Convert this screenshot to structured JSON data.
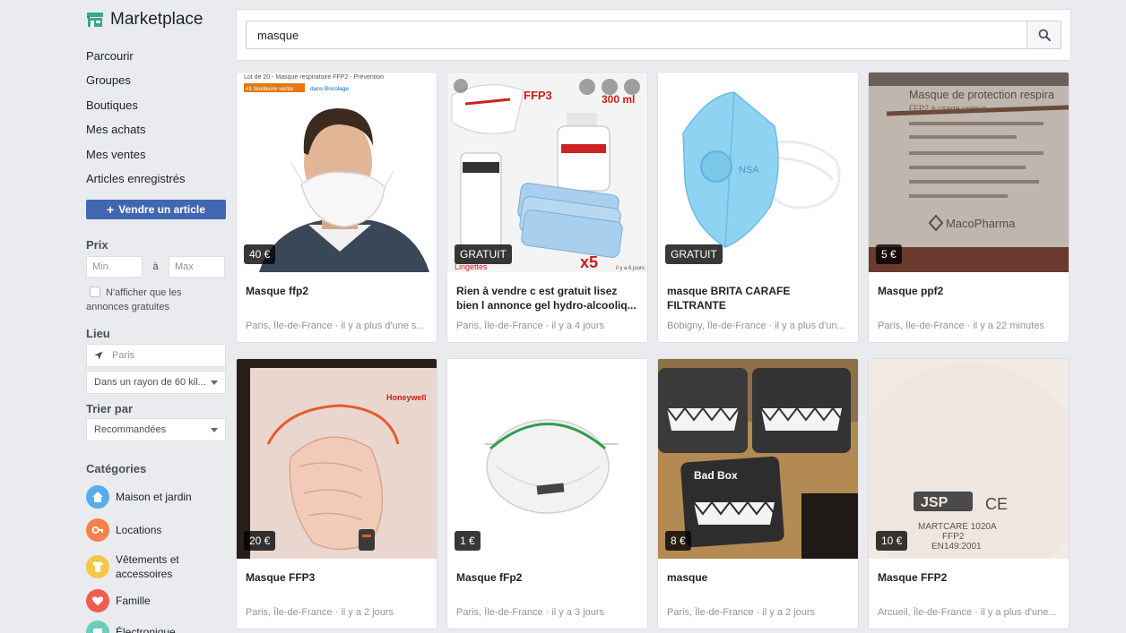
{
  "app": {
    "title": "Marketplace",
    "icon": "shop-icon"
  },
  "nav": [
    {
      "label": "Parcourir"
    },
    {
      "label": "Groupes"
    },
    {
      "label": "Boutiques"
    },
    {
      "label": "Mes achats"
    },
    {
      "label": "Mes ventes"
    },
    {
      "label": "Articles enregistrés"
    }
  ],
  "sell_button": {
    "label": "Vendre un article",
    "icon": "plus-icon"
  },
  "filters": {
    "price": {
      "title": "Prix",
      "min_placeholder": "Min.",
      "separator": "à",
      "max_placeholder": "Max",
      "free_only_label": "N'afficher que les annonces gratuites"
    },
    "location": {
      "title": "Lieu",
      "city": "Paris",
      "radius": "Dans un rayon de 60 kil..."
    },
    "sort": {
      "title": "Trier par",
      "value": "Recommandées"
    }
  },
  "categories": {
    "title": "Catégories",
    "items": [
      {
        "label": "Maison et jardin",
        "icon": "house-icon",
        "color": "#55acee"
      },
      {
        "label": "Locations",
        "icon": "key-icon",
        "color": "#f7814a"
      },
      {
        "label": "Vêtements et accessoires",
        "icon": "clothing-icon",
        "color": "#f7c644"
      },
      {
        "label": "Famille",
        "icon": "heart-icon",
        "color": "#f25b4d"
      },
      {
        "label": "Électronique",
        "icon": "electronics-icon",
        "color": "#6bcebb"
      }
    ]
  },
  "search": {
    "value": "masque",
    "icon": "search-icon"
  },
  "listings": [
    {
      "price": "40 €",
      "title": "Masque ffp2",
      "meta": "Paris, Île-de-France · il y a plus d'une s...",
      "img_banner": "Lot de 20 - Masque respiratoire FFP2 - Prévention",
      "img_tag": "#1 Meilleure vente",
      "img_tag2": "dans Bricolage"
    },
    {
      "price": "GRATUIT",
      "title": "Rien à vendre c est gratuit lisez bien l annonce gel hydro-alcooliq...",
      "meta": "Paris, Île-de-France · il y a 4 jours",
      "img_ffp3": "FFP3",
      "img_ml": "300 ml",
      "img_x5": "x5",
      "img_small": "Lingettes",
      "img_time": "il y a 6 jours"
    },
    {
      "price": "GRATUIT",
      "title": "masque BRITA CARAFE FILTRANTE",
      "meta": "Bobigny, Île-de-France · il y a plus d'un...",
      "img_text": "NSA"
    },
    {
      "price": "5 €",
      "title": "Masque ppf2",
      "meta": "Paris, Île-de-France · il y a 22 minutes",
      "img_heading": "Masque de protection respira",
      "img_sub": "FFP2 à usage unique",
      "img_brand": "MacoPharma"
    },
    {
      "price": "20 €",
      "title": "Masque FFP3",
      "meta": "Paris, Île-de-France · il y a 2 jours",
      "img_brand": "Honeywell"
    },
    {
      "price": "1 €",
      "title": "Masque fFp2",
      "meta": "Paris, Île-de-France · il y a 3 jours"
    },
    {
      "price": "8 €",
      "title": "masque",
      "meta": "Paris, Île-de-France · il y a 2 jours",
      "img_text": "Bad Box"
    },
    {
      "price": "10 €",
      "title": "Masque FFP2",
      "meta": "Arcueil, Île-de-France · il y a plus d'une...",
      "img_brand": "JSP",
      "img_line1": "MARTCARE 1020A",
      "img_line2": "FFP2",
      "img_line3": "EN149:2001",
      "img_ce": "CE"
    }
  ]
}
